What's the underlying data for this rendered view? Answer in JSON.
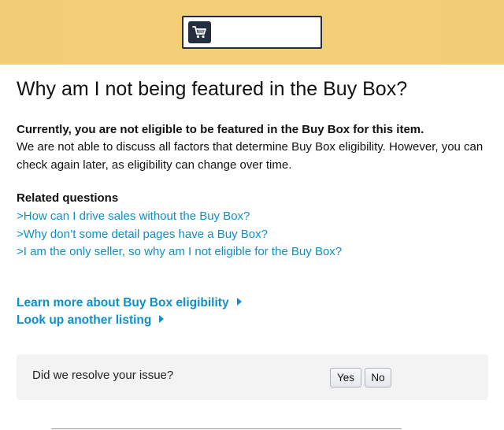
{
  "header": {
    "icon": "shopping-cart-icon",
    "colors": {
      "band": "#f3d078",
      "icon_bg": "#232f3e"
    }
  },
  "main": {
    "title": "Why am I not being featured in the Buy Box?",
    "status_heading": "Currently, you are not eligible to be featured in the Buy Box for this item.",
    "status_text": "We are not able to discuss all factors that determine Buy Box eligibility. However, you can check again later, as eligibility can change over time.",
    "related_title": "Related questions",
    "related_questions": [
      ">How can I drive sales without the Buy Box?",
      ">Why don’t some detail pages have a Buy Box?",
      ">I am the only seller, so why am I not eligible for the Buy Box?"
    ],
    "actions": [
      "Learn more about Buy Box eligibility",
      "Look up another listing"
    ],
    "link_color": "#0f8fc7"
  },
  "feedback": {
    "question": "Did we resolve your issue?",
    "yes_label": "Yes",
    "no_label": "No"
  }
}
